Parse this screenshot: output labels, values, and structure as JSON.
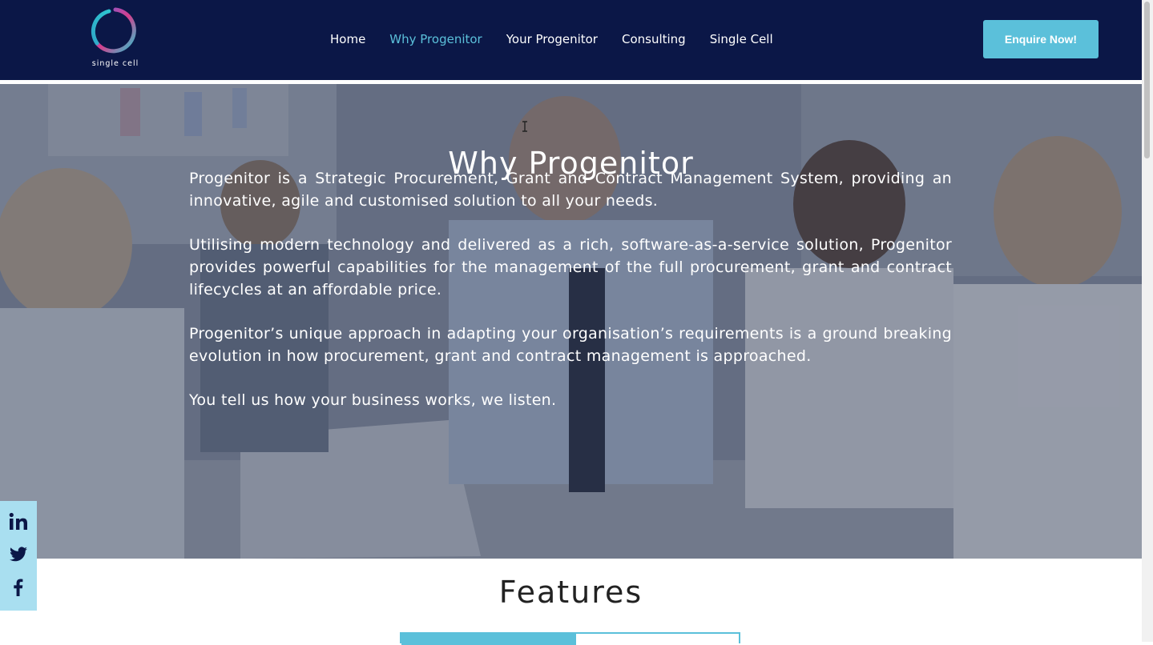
{
  "header": {
    "logo_text": "single cell",
    "nav": [
      "Home",
      "Why Progenitor",
      "Your Progenitor",
      "Consulting",
      "Single Cell"
    ],
    "active_nav": "Why Progenitor",
    "cta_label": "Enquire Now!"
  },
  "hero": {
    "title": "Why Progenitor",
    "paragraphs": [
      "Progenitor is a Strategic Procurement, Grant and Contract Management System, providing an innovative, agile and customised solution to all your needs.",
      "Utilising modern technology and delivered as a rich, software-as-a-service solution, Progenitor provides powerful capabilities for the management of the full procurement, grant and contract lifecycles at an affordable price.",
      "Progenitor’s unique approach in adapting your organisation’s requirements is a ground breaking evolution in how procurement, grant and contract management is approached.",
      "You tell us how your business works, we listen."
    ]
  },
  "social": {
    "icons": [
      "linkedin-icon",
      "twitter-icon",
      "facebook-icon"
    ]
  },
  "features": {
    "title": "Features"
  },
  "colors": {
    "header_bg": "#0b1747",
    "accent": "#5bc0da",
    "social_bg": "#a9dff0"
  }
}
